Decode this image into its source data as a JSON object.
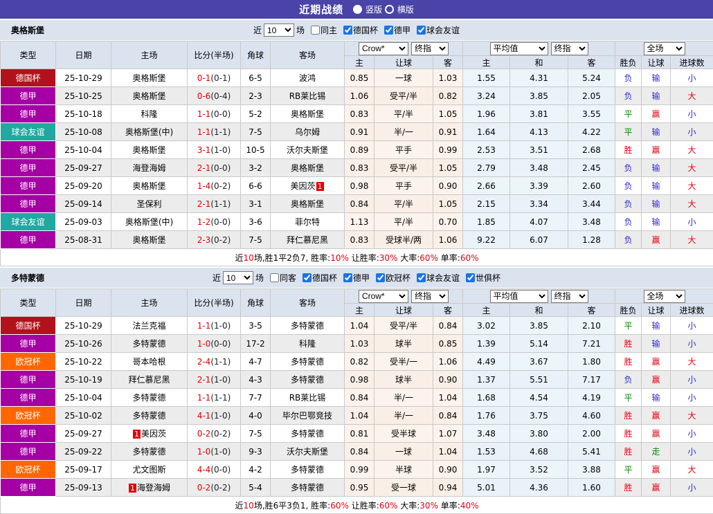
{
  "title": "近期战绩",
  "view_options": [
    {
      "label": "竖版",
      "selected": true
    },
    {
      "label": "横版",
      "selected": false
    }
  ],
  "theme": {
    "header_bg": "#4a43a8",
    "section_bg": "#dbe3ef",
    "odds_bg": "#fbf3ec",
    "avg_bg": "#ecf5fa",
    "win_red": "#e60012",
    "lose_blue": "#2a2ad4",
    "draw_green": "#028a02",
    "team_green": "#008000",
    "league_colors": {
      "德国杯": "#b1121b",
      "德甲": "#a400a4",
      "球会友谊": "#1fa9a0",
      "欧冠杯": "#ff6600"
    }
  },
  "main_headers": [
    "类型",
    "日期",
    "主场",
    "比分(半场)",
    "角球",
    "客场"
  ],
  "sub_headers": [
    "主",
    "让球",
    "客",
    "主",
    "和",
    "客",
    "胜负",
    "让球",
    "进球数"
  ],
  "sections": [
    {
      "team": "奥格斯堡",
      "filter": {
        "prefix": "近",
        "count": "10",
        "suffix": "场",
        "same_side": {
          "label": "同主",
          "checked": false
        },
        "leagues": [
          {
            "label": "德国杯",
            "checked": true
          },
          {
            "label": "德甲",
            "checked": true
          },
          {
            "label": "球会友谊",
            "checked": true
          }
        ]
      },
      "dropdowns": {
        "odds_source": "Crow*",
        "odds_time": "终指",
        "avg_source": "平均值",
        "avg_time": "终指",
        "scope": "全场"
      },
      "rows": [
        {
          "type": "德国杯",
          "date": "25-10-29",
          "home": {
            "n": "奥格斯堡",
            "hl": true
          },
          "score": [
            "0-1",
            "(0-1)"
          ],
          "corner": "6-5",
          "away": {
            "n": "波鸿"
          },
          "odds": [
            "0.85",
            "一球",
            "1.03"
          ],
          "avg": [
            "1.55",
            "4.31",
            "5.24"
          ],
          "res": [
            [
              "负",
              "blue"
            ],
            [
              "输",
              "blue"
            ],
            [
              "小",
              "blue"
            ]
          ]
        },
        {
          "type": "德甲",
          "date": "25-10-25",
          "home": {
            "n": "奥格斯堡",
            "hl": true
          },
          "score": [
            "0-6",
            "(0-4)"
          ],
          "corner": "2-3",
          "away": {
            "n": "RB莱比锡"
          },
          "odds": [
            "1.06",
            "受平/半",
            "0.82"
          ],
          "avg": [
            "3.24",
            "3.85",
            "2.05"
          ],
          "res": [
            [
              "负",
              "blue"
            ],
            [
              "输",
              "blue"
            ],
            [
              "大",
              "red"
            ]
          ]
        },
        {
          "type": "德甲",
          "date": "25-10-18",
          "home": {
            "n": "科隆"
          },
          "score": [
            "1-1",
            "(0-0)"
          ],
          "corner": "5-2",
          "away": {
            "n": "奥格斯堡",
            "hl": true
          },
          "odds": [
            "0.83",
            "平/半",
            "1.05"
          ],
          "avg": [
            "1.96",
            "3.81",
            "3.55"
          ],
          "res": [
            [
              "平",
              "green"
            ],
            [
              "赢",
              "red"
            ],
            [
              "小",
              "blue"
            ]
          ]
        },
        {
          "type": "球会友谊",
          "date": "25-10-08",
          "home": {
            "n": "奥格斯堡(中)",
            "hl": true
          },
          "score": [
            "1-1",
            "(1-1)"
          ],
          "corner": "7-5",
          "away": {
            "n": "乌尔姆"
          },
          "odds": [
            "0.91",
            "半/一",
            "0.91"
          ],
          "avg": [
            "1.64",
            "4.13",
            "4.22"
          ],
          "res": [
            [
              "平",
              "green"
            ],
            [
              "输",
              "blue"
            ],
            [
              "小",
              "blue"
            ]
          ]
        },
        {
          "type": "德甲",
          "date": "25-10-04",
          "home": {
            "n": "奥格斯堡",
            "hl": true
          },
          "score": [
            "3-1",
            "(1-0)"
          ],
          "corner": "10-5",
          "away": {
            "n": "沃尔夫斯堡"
          },
          "odds": [
            "0.89",
            "平手",
            "0.99"
          ],
          "avg": [
            "2.53",
            "3.51",
            "2.68"
          ],
          "res": [
            [
              "胜",
              "red"
            ],
            [
              "赢",
              "red"
            ],
            [
              "大",
              "red"
            ]
          ]
        },
        {
          "type": "德甲",
          "date": "25-09-27",
          "home": {
            "n": "海登海姆"
          },
          "score": [
            "2-1",
            "(0-0)"
          ],
          "corner": "3-2",
          "away": {
            "n": "奥格斯堡",
            "hl": true
          },
          "odds": [
            "0.83",
            "受平/半",
            "1.05"
          ],
          "avg": [
            "2.79",
            "3.48",
            "2.45"
          ],
          "res": [
            [
              "负",
              "blue"
            ],
            [
              "输",
              "blue"
            ],
            [
              "大",
              "red"
            ]
          ]
        },
        {
          "type": "德甲",
          "date": "25-09-20",
          "home": {
            "n": "奥格斯堡",
            "hl": true
          },
          "score": [
            "1-4",
            "(0-2)"
          ],
          "corner": "6-6",
          "away": {
            "n": "美因茨",
            "badge": "1",
            "badge_pos": "after"
          },
          "odds": [
            "0.98",
            "平手",
            "0.90"
          ],
          "avg": [
            "2.66",
            "3.39",
            "2.60"
          ],
          "res": [
            [
              "负",
              "blue"
            ],
            [
              "输",
              "blue"
            ],
            [
              "大",
              "red"
            ]
          ]
        },
        {
          "type": "德甲",
          "date": "25-09-14",
          "home": {
            "n": "圣保利"
          },
          "score": [
            "2-1",
            "(1-1)"
          ],
          "corner": "3-1",
          "away": {
            "n": "奥格斯堡",
            "hl": true
          },
          "odds": [
            "0.84",
            "平/半",
            "1.05"
          ],
          "avg": [
            "2.15",
            "3.34",
            "3.44"
          ],
          "res": [
            [
              "负",
              "blue"
            ],
            [
              "输",
              "blue"
            ],
            [
              "大",
              "red"
            ]
          ]
        },
        {
          "type": "球会友谊",
          "date": "25-09-03",
          "home": {
            "n": "奥格斯堡(中)",
            "hl": true
          },
          "score": [
            "1-2",
            "(0-0)"
          ],
          "corner": "3-6",
          "away": {
            "n": "菲尔特"
          },
          "odds": [
            "1.13",
            "平/半",
            "0.70"
          ],
          "avg": [
            "1.85",
            "4.07",
            "3.48"
          ],
          "res": [
            [
              "负",
              "blue"
            ],
            [
              "输",
              "blue"
            ],
            [
              "小",
              "blue"
            ]
          ]
        },
        {
          "type": "德甲",
          "date": "25-08-31",
          "home": {
            "n": "奥格斯堡",
            "hl": true,
            "underline": true
          },
          "score": [
            "2-3",
            "(0-2)"
          ],
          "corner": "7-5",
          "away": {
            "n": "拜仁慕尼黑"
          },
          "odds": [
            "0.83",
            "受球半/两",
            "1.06"
          ],
          "avg": [
            "9.22",
            "6.07",
            "1.28"
          ],
          "res": [
            [
              "负",
              "blue"
            ],
            [
              "赢",
              "red"
            ],
            [
              "大",
              "red"
            ]
          ]
        }
      ],
      "summary": [
        {
          "t": "近",
          "red": false
        },
        {
          "t": "10",
          "red": true
        },
        {
          "t": "场,胜1平2负7, 胜率:",
          "red": false
        },
        {
          "t": "10%",
          "red": true
        },
        {
          "t": " 让胜率:",
          "red": false
        },
        {
          "t": "30%",
          "red": true
        },
        {
          "t": " 大率:",
          "red": false
        },
        {
          "t": "60%",
          "red": true
        },
        {
          "t": " 单率:",
          "red": false
        },
        {
          "t": "60%",
          "red": true
        }
      ]
    },
    {
      "team": "多特蒙德",
      "filter": {
        "prefix": "近",
        "count": "10",
        "suffix": "场",
        "same_side": {
          "label": "同客",
          "checked": false
        },
        "leagues": [
          {
            "label": "德国杯",
            "checked": true
          },
          {
            "label": "德甲",
            "checked": true
          },
          {
            "label": "欧冠杯",
            "checked": true
          },
          {
            "label": "球会友谊",
            "checked": true
          },
          {
            "label": "世俱杯",
            "checked": true
          }
        ]
      },
      "dropdowns": {
        "odds_source": "Crow*",
        "odds_time": "终指",
        "avg_source": "平均值",
        "avg_time": "终指",
        "scope": "全场"
      },
      "rows": [
        {
          "type": "德国杯",
          "date": "25-10-29",
          "home": {
            "n": "法兰克福"
          },
          "score": [
            "1-1",
            "(1-0)"
          ],
          "corner": "3-5",
          "away": {
            "n": "多特蒙德",
            "hl": true
          },
          "odds": [
            "1.04",
            "受平/半",
            "0.84"
          ],
          "avg": [
            "3.02",
            "3.85",
            "2.10"
          ],
          "res": [
            [
              "平",
              "green"
            ],
            [
              "输",
              "blue"
            ],
            [
              "小",
              "blue"
            ]
          ]
        },
        {
          "type": "德甲",
          "date": "25-10-26",
          "home": {
            "n": "多特蒙德",
            "hl": true
          },
          "score": [
            "1-0",
            "(0-0)"
          ],
          "corner": "17-2",
          "away": {
            "n": "科隆"
          },
          "odds": [
            "1.03",
            "球半",
            "0.85"
          ],
          "avg": [
            "1.39",
            "5.14",
            "7.21"
          ],
          "res": [
            [
              "胜",
              "red"
            ],
            [
              "输",
              "blue"
            ],
            [
              "小",
              "blue"
            ]
          ]
        },
        {
          "type": "欧冠杯",
          "date": "25-10-22",
          "home": {
            "n": "哥本哈根"
          },
          "score": [
            "2-4",
            "(1-1)"
          ],
          "corner": "4-7",
          "away": {
            "n": "多特蒙德",
            "hl": true
          },
          "odds": [
            "0.82",
            "受半/一",
            "1.06"
          ],
          "avg": [
            "4.49",
            "3.67",
            "1.80"
          ],
          "res": [
            [
              "胜",
              "red"
            ],
            [
              "赢",
              "red"
            ],
            [
              "大",
              "red"
            ]
          ]
        },
        {
          "type": "德甲",
          "date": "25-10-19",
          "home": {
            "n": "拜仁慕尼黑"
          },
          "score": [
            "2-1",
            "(1-0)"
          ],
          "corner": "4-3",
          "away": {
            "n": "多特蒙德",
            "hl": true
          },
          "odds": [
            "0.98",
            "球半",
            "0.90"
          ],
          "avg": [
            "1.37",
            "5.51",
            "7.17"
          ],
          "res": [
            [
              "负",
              "blue"
            ],
            [
              "赢",
              "red"
            ],
            [
              "小",
              "blue"
            ]
          ]
        },
        {
          "type": "德甲",
          "date": "25-10-04",
          "home": {
            "n": "多特蒙德",
            "hl": true
          },
          "score": [
            "1-1",
            "(1-1)"
          ],
          "corner": "7-7",
          "away": {
            "n": "RB莱比锡"
          },
          "odds": [
            "0.84",
            "半/一",
            "1.04"
          ],
          "avg": [
            "1.68",
            "4.54",
            "4.19"
          ],
          "res": [
            [
              "平",
              "green"
            ],
            [
              "输",
              "blue"
            ],
            [
              "小",
              "blue"
            ]
          ]
        },
        {
          "type": "欧冠杯",
          "date": "25-10-02",
          "home": {
            "n": "多特蒙德",
            "hl": true
          },
          "score": [
            "4-1",
            "(1-0)"
          ],
          "corner": "4-0",
          "away": {
            "n": "毕尔巴鄂竞技"
          },
          "odds": [
            "1.04",
            "半/一",
            "0.84"
          ],
          "avg": [
            "1.76",
            "3.75",
            "4.60"
          ],
          "res": [
            [
              "胜",
              "red"
            ],
            [
              "赢",
              "red"
            ],
            [
              "大",
              "red"
            ]
          ]
        },
        {
          "type": "德甲",
          "date": "25-09-27",
          "home": {
            "n": "美因茨",
            "badge": "1",
            "badge_pos": "before"
          },
          "score": [
            "0-2",
            "(0-2)"
          ],
          "corner": "7-5",
          "away": {
            "n": "多特蒙德",
            "hl": true
          },
          "odds": [
            "0.81",
            "受半球",
            "1.07"
          ],
          "avg": [
            "3.48",
            "3.80",
            "2.00"
          ],
          "res": [
            [
              "胜",
              "red"
            ],
            [
              "赢",
              "red"
            ],
            [
              "小",
              "blue"
            ]
          ]
        },
        {
          "type": "德甲",
          "date": "25-09-22",
          "home": {
            "n": "多特蒙德",
            "hl": true
          },
          "score": [
            "1-0",
            "(1-0)"
          ],
          "corner": "9-3",
          "away": {
            "n": "沃尔夫斯堡"
          },
          "odds": [
            "0.84",
            "一球",
            "1.04"
          ],
          "avg": [
            "1.53",
            "4.68",
            "5.41"
          ],
          "res": [
            [
              "胜",
              "red"
            ],
            [
              "走",
              "green"
            ],
            [
              "小",
              "blue"
            ]
          ]
        },
        {
          "type": "欧冠杯",
          "date": "25-09-17",
          "home": {
            "n": "尤文图斯"
          },
          "score": [
            "4-4",
            "(0-0)"
          ],
          "corner": "4-2",
          "away": {
            "n": "多特蒙德",
            "hl": true
          },
          "odds": [
            "0.99",
            "半球",
            "0.90"
          ],
          "avg": [
            "1.97",
            "3.52",
            "3.88"
          ],
          "res": [
            [
              "平",
              "green"
            ],
            [
              "赢",
              "red"
            ],
            [
              "大",
              "red"
            ]
          ]
        },
        {
          "type": "德甲",
          "date": "25-09-13",
          "home": {
            "n": "海登海姆",
            "badge": "1",
            "badge_pos": "before"
          },
          "score": [
            "0-2",
            "(0-2)"
          ],
          "corner": "5-4",
          "away": {
            "n": "多特蒙德",
            "hl": true
          },
          "odds": [
            "0.95",
            "受一球",
            "0.94"
          ],
          "avg": [
            "5.01",
            "4.36",
            "1.60"
          ],
          "res": [
            [
              "胜",
              "red"
            ],
            [
              "赢",
              "red"
            ],
            [
              "小",
              "blue"
            ]
          ]
        }
      ],
      "summary": [
        {
          "t": "近",
          "red": false
        },
        {
          "t": "10",
          "red": true
        },
        {
          "t": "场,胜6平3负1, 胜率:",
          "red": false
        },
        {
          "t": "60%",
          "red": true
        },
        {
          "t": " 让胜率:",
          "red": false
        },
        {
          "t": "60%",
          "red": true
        },
        {
          "t": " 大率:",
          "red": false
        },
        {
          "t": "30%",
          "red": true
        },
        {
          "t": " 单率:",
          "red": false
        },
        {
          "t": "40%",
          "red": true
        }
      ]
    }
  ]
}
